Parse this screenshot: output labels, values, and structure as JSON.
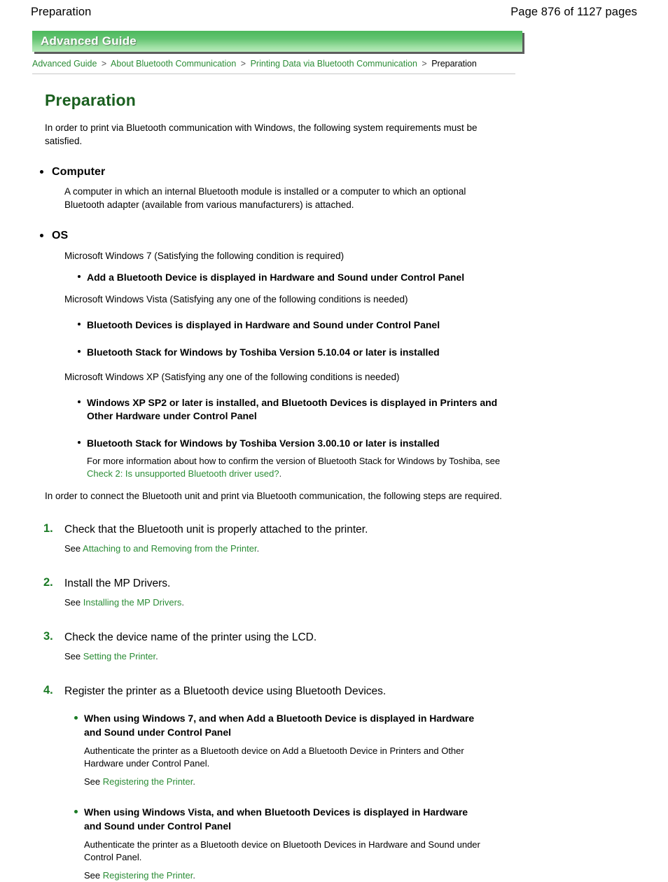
{
  "page_header": {
    "title": "Preparation",
    "pagination": "Page 876 of 1127 pages"
  },
  "banner": {
    "label": "Advanced Guide"
  },
  "breadcrumb": {
    "separator": ">",
    "items": [
      {
        "label": "Advanced Guide",
        "link": true
      },
      {
        "label": "About Bluetooth Communication",
        "link": true
      },
      {
        "label": "Printing Data via Bluetooth Communication",
        "link": true
      },
      {
        "label": "Preparation",
        "link": false
      }
    ]
  },
  "doc": {
    "title": "Preparation",
    "intro": "In order to print via Bluetooth communication with Windows, the following system requirements must be satisfied.",
    "connect_note": "In order to connect the Bluetooth unit and print via Bluetooth communication, the following steps are required."
  },
  "requirements": {
    "computer": {
      "heading": "Computer",
      "body": "A computer in which an internal Bluetooth module is installed or a computer to which an optional Bluetooth adapter (available from various manufacturers) is attached."
    },
    "os": {
      "heading": "OS",
      "win7_line": "Microsoft Windows 7 (Satisfying the following condition is required)",
      "win7_conditions": [
        "Add a Bluetooth Device is displayed in Hardware and Sound under Control Panel"
      ],
      "vista_line": "Microsoft Windows Vista (Satisfying any one of the following conditions is needed)",
      "vista_conditions": [
        "Bluetooth Devices is displayed in Hardware and Sound under Control Panel",
        "Bluetooth Stack for Windows by Toshiba Version 5.10.04 or later is installed"
      ],
      "xp_line": "Microsoft Windows XP (Satisfying any one of the following conditions is needed)",
      "xp_conditions": [
        "Windows XP SP2 or later is installed, and Bluetooth Devices is displayed in Printers and Other Hardware under Control Panel",
        "Bluetooth Stack for Windows by Toshiba Version 3.00.10 or later is installed"
      ],
      "xp_note_prefix": "For more information about how to confirm the version of Bluetooth Stack for Windows by Toshiba, see ",
      "xp_note_link": "Check 2: Is unsupported Bluetooth driver used?",
      "xp_note_suffix": "."
    }
  },
  "steps": [
    {
      "number": "1.",
      "title": "Check that the Bluetooth unit is properly attached to the printer.",
      "see_label": "See ",
      "see_link": "Attaching to and Removing from the Printer",
      "see_suffix": "."
    },
    {
      "number": "2.",
      "title": "Install the MP Drivers.",
      "see_label": "See ",
      "see_link": "Installing the MP Drivers",
      "see_suffix": "."
    },
    {
      "number": "3.",
      "title": "Check the device name of the printer using the LCD.",
      "see_label": "See ",
      "see_link": "Setting the Printer",
      "see_suffix": "."
    },
    {
      "number": "4.",
      "title": "Register the printer as a Bluetooth device using Bluetooth Devices.",
      "groups": [
        {
          "heading": "When using Windows 7, and when Add a Bluetooth Device is displayed in Hardware and Sound under Control Panel",
          "body": "Authenticate the printer as a Bluetooth device on Add a Bluetooth Device in Printers and Other Hardware under Control Panel.",
          "see_label": "See ",
          "see_link": "Registering the Printer",
          "see_suffix": "."
        },
        {
          "heading": "When using Windows Vista, and when Bluetooth Devices is displayed in Hardware and Sound under Control Panel",
          "body": "Authenticate the printer as a Bluetooth device on Bluetooth Devices in Hardware and Sound under Control Panel.",
          "see_label": "See ",
          "see_link": "Registering the Printer",
          "see_suffix": "."
        }
      ]
    }
  ],
  "colors": {
    "banner_green_top": "#4cb85c",
    "banner_green_bottom": "#b9e9bb",
    "title_green": "#1a5f1f",
    "link_green": "#2b8c36",
    "step_number_green": "#1a7a24",
    "rule_gray": "#c8c8c8"
  }
}
